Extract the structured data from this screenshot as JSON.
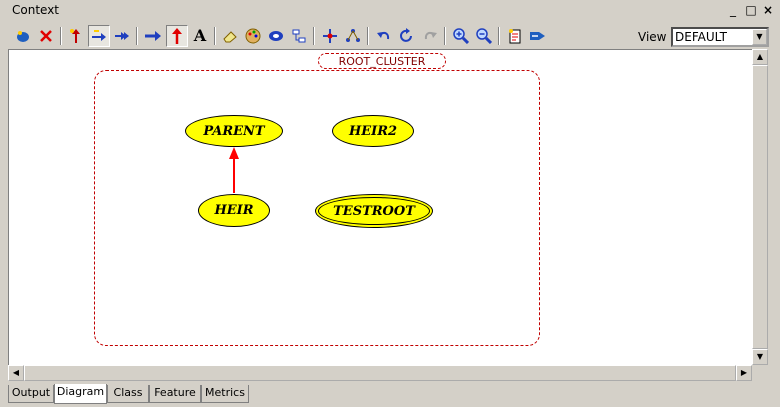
{
  "window": {
    "title": "Context",
    "minimize": "_",
    "maximize": "□",
    "close": "×"
  },
  "toolbar": {
    "view_label": "View",
    "view_value": "DEFAULT",
    "icons": [
      "new-cluster-icon",
      "delete-icon",
      "add-inheritance-icon",
      "show-ancestors-icon",
      "show-descendants-icon",
      "client-supplier-icon",
      "inheritance-link-icon",
      "label-icon",
      "eraser-icon",
      "palette-icon",
      "fill-icon",
      "link-tool-icon",
      "center-icon",
      "layout-icon",
      "undo-icon",
      "redo-icon",
      "redo-disabled-icon",
      "zoom-in-icon",
      "zoom-out-icon",
      "export-icon",
      "export-png-icon"
    ]
  },
  "diagram": {
    "cluster_label": "ROOT_CLUSTER",
    "nodes": {
      "parent": "PARENT",
      "heir2": "HEIR2",
      "heir": "HEIR",
      "testroot": "TESTROOT"
    },
    "edges": [
      {
        "from": "HEIR",
        "to": "PARENT",
        "color": "#ff0000"
      }
    ]
  },
  "tabs": [
    "Output",
    "Diagram",
    "Class",
    "Feature",
    "Metrics"
  ],
  "active_tab": "Diagram",
  "colors": {
    "node_fill": "#ffff00",
    "cluster_border": "#c00000",
    "edge": "#ff0000",
    "chrome": "#d4d0c8"
  }
}
